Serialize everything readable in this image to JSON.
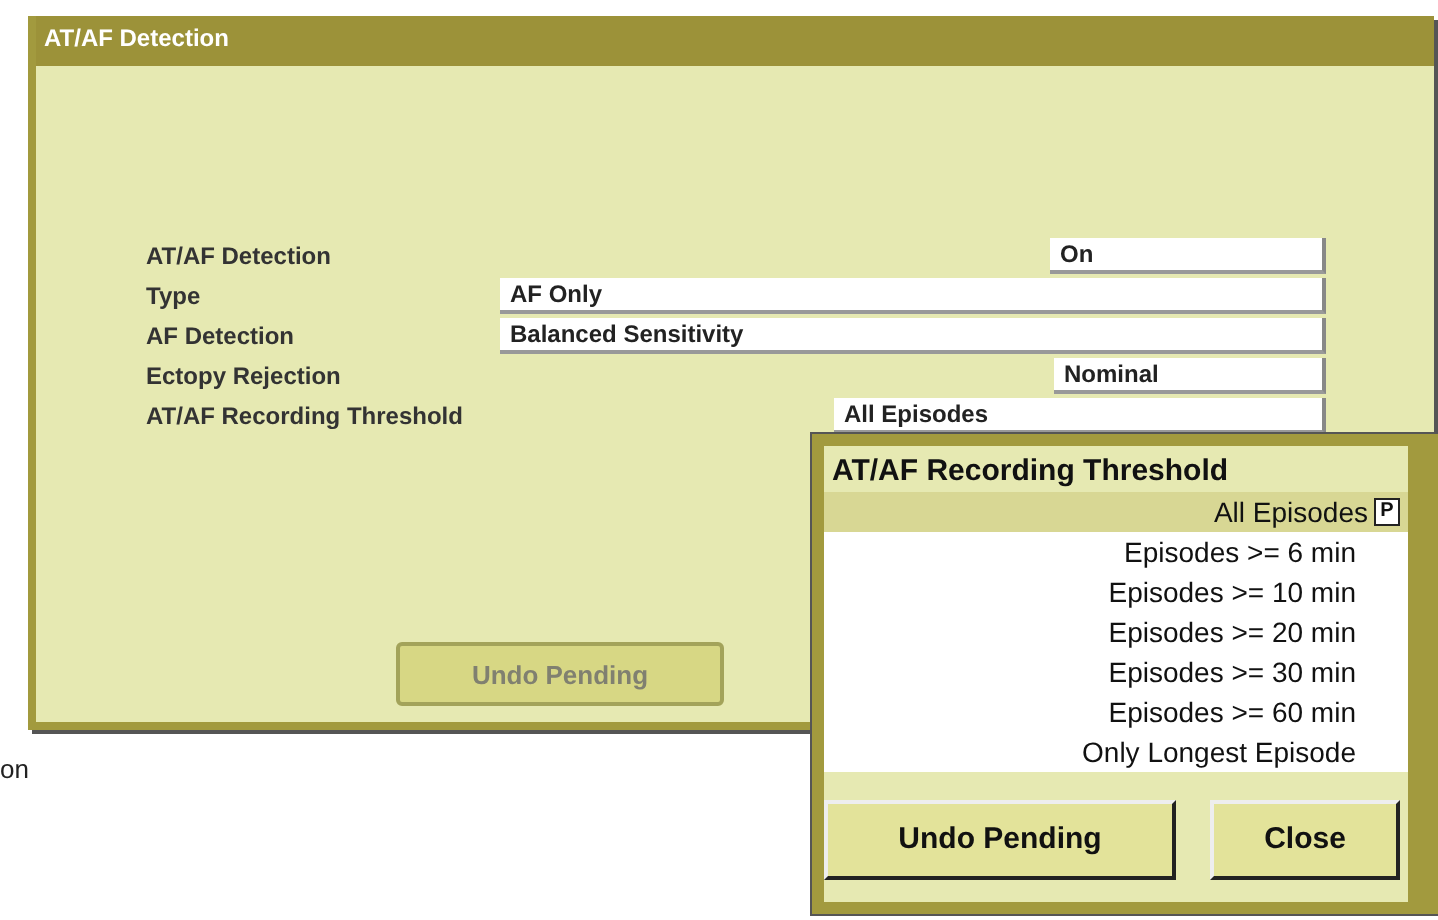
{
  "window": {
    "title": "AT/AF Detection"
  },
  "settings": [
    {
      "label": "AT/AF Detection",
      "value": "On"
    },
    {
      "label": "Type",
      "value": "AF Only"
    },
    {
      "label": "AF Detection",
      "value": "Balanced Sensitivity"
    },
    {
      "label": "Ectopy Rejection",
      "value": "Nominal"
    },
    {
      "label": "AT/AF Recording Threshold",
      "value": "All Episodes"
    }
  ],
  "undo_button": {
    "label": "Undo Pending",
    "disabled": true
  },
  "side_text": "on",
  "popup": {
    "title": "AT/AF Recording Threshold",
    "options": [
      {
        "label": "All Episodes",
        "selected": true,
        "badge": "P"
      },
      {
        "label": "Episodes >= 6 min",
        "selected": false
      },
      {
        "label": "Episodes >= 10 min",
        "selected": false
      },
      {
        "label": "Episodes >= 20 min",
        "selected": false
      },
      {
        "label": "Episodes >= 30 min",
        "selected": false
      },
      {
        "label": "Episodes >= 60 min",
        "selected": false
      },
      {
        "label": "Only Longest Episode",
        "selected": false
      }
    ],
    "buttons": [
      "Undo Pending",
      "Close"
    ]
  }
}
